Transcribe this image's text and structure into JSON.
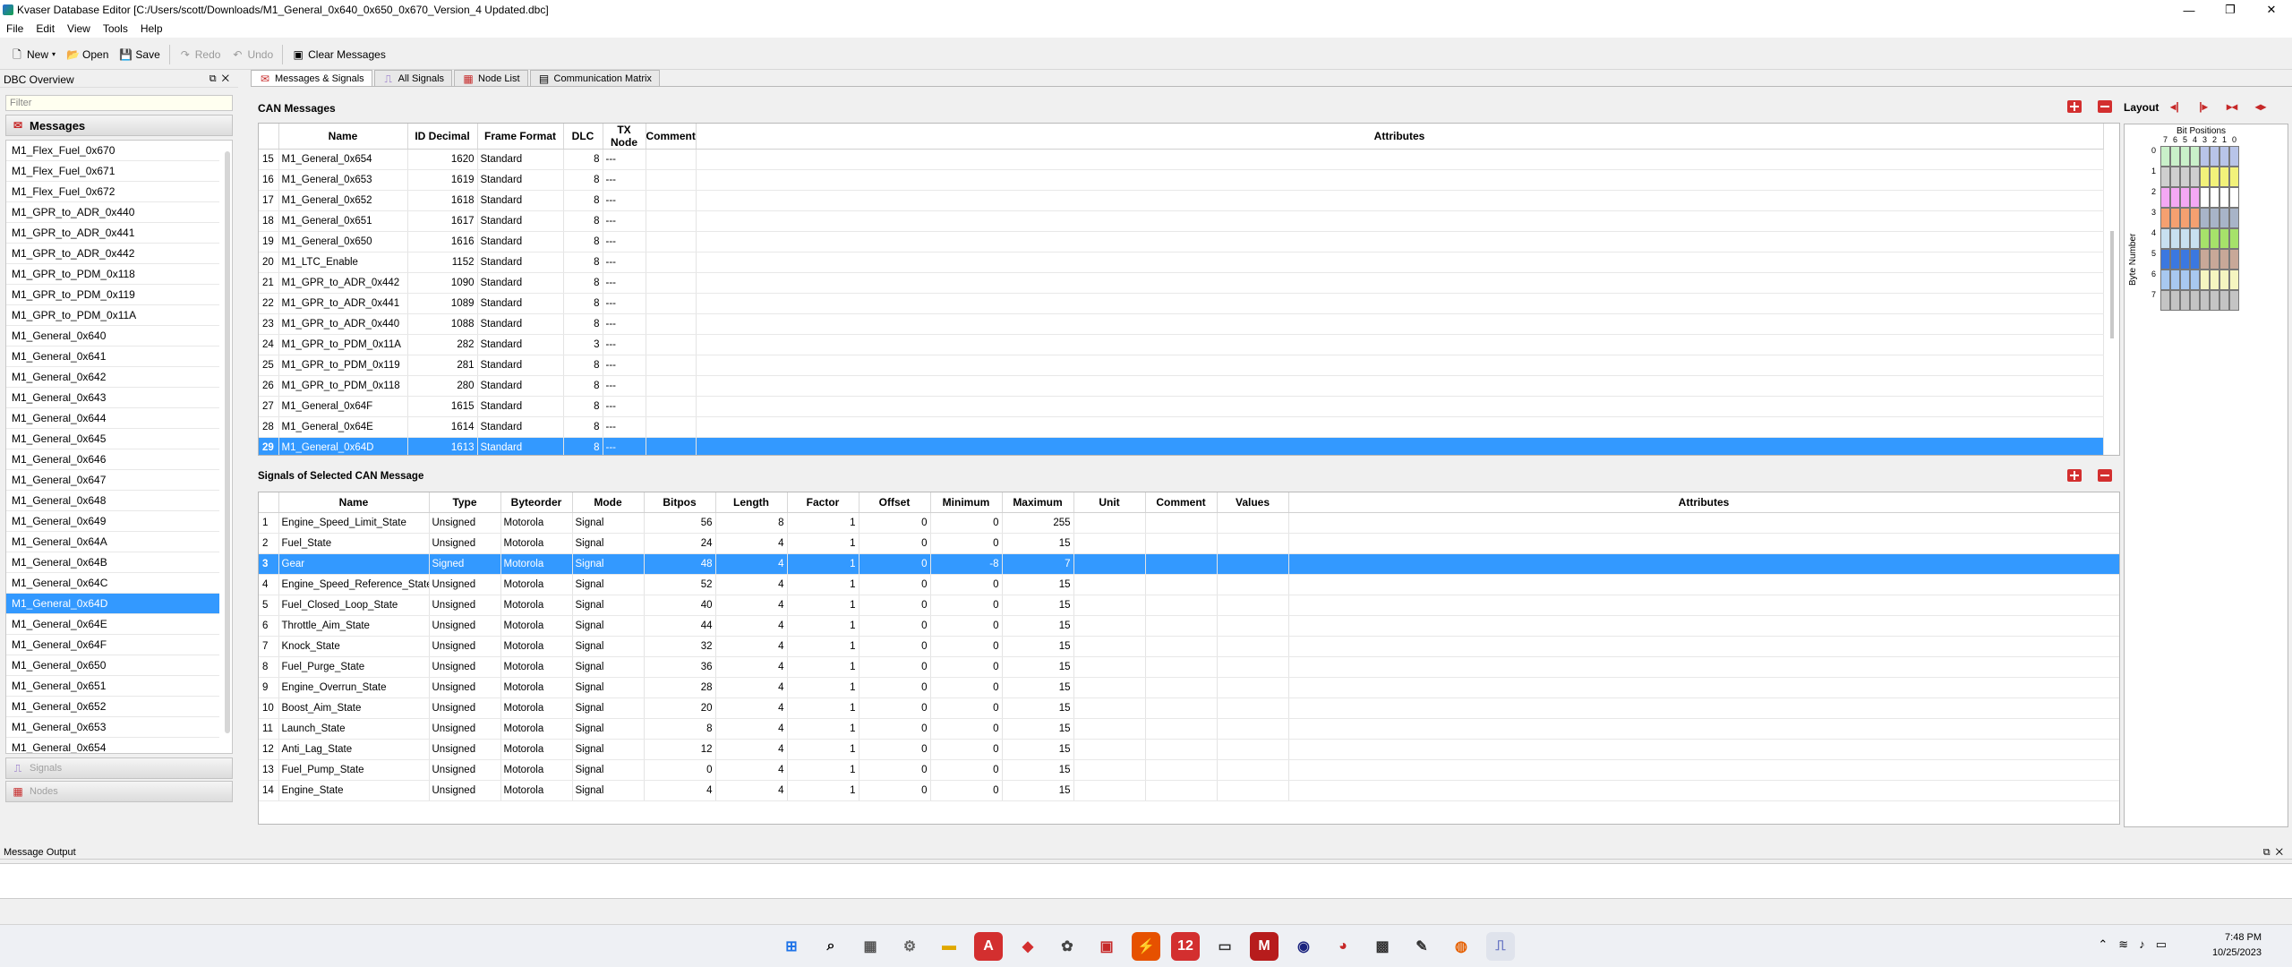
{
  "window": {
    "title": "Kvaser Database Editor [C:/Users/scott/Downloads/M1_General_0x640_0x650_0x670_Version_4 Updated.dbc]",
    "min": "—",
    "max": "❐",
    "close": "✕"
  },
  "menu": [
    "File",
    "Edit",
    "View",
    "Tools",
    "Help"
  ],
  "toolbar": {
    "new": "New",
    "open": "Open",
    "save": "Save",
    "redo": "Redo",
    "undo": "Undo",
    "clear": "Clear Messages"
  },
  "left": {
    "header": "DBC Overview",
    "filter_placeholder": "Filter",
    "messages_label": "Messages",
    "signals_label": "Signals",
    "nodes_label": "Nodes",
    "items": [
      "M1_Flex_Fuel_0x670",
      "M1_Flex_Fuel_0x671",
      "M1_Flex_Fuel_0x672",
      "M1_GPR_to_ADR_0x440",
      "M1_GPR_to_ADR_0x441",
      "M1_GPR_to_ADR_0x442",
      "M1_GPR_to_PDM_0x118",
      "M1_GPR_to_PDM_0x119",
      "M1_GPR_to_PDM_0x11A",
      "M1_General_0x640",
      "M1_General_0x641",
      "M1_General_0x642",
      "M1_General_0x643",
      "M1_General_0x644",
      "M1_General_0x645",
      "M1_General_0x646",
      "M1_General_0x647",
      "M1_General_0x648",
      "M1_General_0x649",
      "M1_General_0x64A",
      "M1_General_0x64B",
      "M1_General_0x64C",
      "M1_General_0x64D",
      "M1_General_0x64E",
      "M1_General_0x64F",
      "M1_General_0x650",
      "M1_General_0x651",
      "M1_General_0x652",
      "M1_General_0x653",
      "M1_General_0x654"
    ],
    "selected_index": 22
  },
  "tabs": [
    "Messages & Signals",
    "All Signals",
    "Node List",
    "Communication Matrix"
  ],
  "can": {
    "title": "CAN Messages",
    "layout_label": "Layout",
    "columns": [
      "Name",
      "ID Decimal",
      "Frame Format",
      "DLC",
      "TX Node",
      "Comment",
      "Attributes"
    ],
    "rows": [
      [
        "15",
        "M1_General_0x654",
        "1620",
        "Standard",
        "8",
        "---"
      ],
      [
        "16",
        "M1_General_0x653",
        "1619",
        "Standard",
        "8",
        "---"
      ],
      [
        "17",
        "M1_General_0x652",
        "1618",
        "Standard",
        "8",
        "---"
      ],
      [
        "18",
        "M1_General_0x651",
        "1617",
        "Standard",
        "8",
        "---"
      ],
      [
        "19",
        "M1_General_0x650",
        "1616",
        "Standard",
        "8",
        "---"
      ],
      [
        "20",
        "M1_LTC_Enable",
        "1152",
        "Standard",
        "8",
        "---"
      ],
      [
        "21",
        "M1_GPR_to_ADR_0x442",
        "1090",
        "Standard",
        "8",
        "---"
      ],
      [
        "22",
        "M1_GPR_to_ADR_0x441",
        "1089",
        "Standard",
        "8",
        "---"
      ],
      [
        "23",
        "M1_GPR_to_ADR_0x440",
        "1088",
        "Standard",
        "8",
        "---"
      ],
      [
        "24",
        "M1_GPR_to_PDM_0x11A",
        "282",
        "Standard",
        "3",
        "---"
      ],
      [
        "25",
        "M1_GPR_to_PDM_0x119",
        "281",
        "Standard",
        "8",
        "---"
      ],
      [
        "26",
        "M1_GPR_to_PDM_0x118",
        "280",
        "Standard",
        "8",
        "---"
      ],
      [
        "27",
        "M1_General_0x64F",
        "1615",
        "Standard",
        "8",
        "---"
      ],
      [
        "28",
        "M1_General_0x64E",
        "1614",
        "Standard",
        "8",
        "---"
      ],
      [
        "29",
        "M1_General_0x64D",
        "1613",
        "Standard",
        "8",
        "---"
      ]
    ],
    "selected_row": 14
  },
  "signals": {
    "title": "Signals of Selected CAN Message",
    "columns": [
      "Name",
      "Type",
      "Byteorder",
      "Mode",
      "Bitpos",
      "Length",
      "Factor",
      "Offset",
      "Minimum",
      "Maximum",
      "Unit",
      "Comment",
      "Values",
      "Attributes"
    ],
    "rows": [
      [
        "1",
        "Engine_Speed_Limit_State",
        "Unsigned",
        "Motorola",
        "Signal",
        "56",
        "8",
        "1",
        "0",
        "0",
        "255"
      ],
      [
        "2",
        "Fuel_State",
        "Unsigned",
        "Motorola",
        "Signal",
        "24",
        "4",
        "1",
        "0",
        "0",
        "15"
      ],
      [
        "3",
        "Gear",
        "Signed",
        "Motorola",
        "Signal",
        "48",
        "4",
        "1",
        "0",
        "-8",
        "7"
      ],
      [
        "4",
        "Engine_Speed_Reference_State",
        "Unsigned",
        "Motorola",
        "Signal",
        "52",
        "4",
        "1",
        "0",
        "0",
        "15"
      ],
      [
        "5",
        "Fuel_Closed_Loop_State",
        "Unsigned",
        "Motorola",
        "Signal",
        "40",
        "4",
        "1",
        "0",
        "0",
        "15"
      ],
      [
        "6",
        "Throttle_Aim_State",
        "Unsigned",
        "Motorola",
        "Signal",
        "44",
        "4",
        "1",
        "0",
        "0",
        "15"
      ],
      [
        "7",
        "Knock_State",
        "Unsigned",
        "Motorola",
        "Signal",
        "32",
        "4",
        "1",
        "0",
        "0",
        "15"
      ],
      [
        "8",
        "Fuel_Purge_State",
        "Unsigned",
        "Motorola",
        "Signal",
        "36",
        "4",
        "1",
        "0",
        "0",
        "15"
      ],
      [
        "9",
        "Engine_Overrun_State",
        "Unsigned",
        "Motorola",
        "Signal",
        "28",
        "4",
        "1",
        "0",
        "0",
        "15"
      ],
      [
        "10",
        "Boost_Aim_State",
        "Unsigned",
        "Motorola",
        "Signal",
        "20",
        "4",
        "1",
        "0",
        "0",
        "15"
      ],
      [
        "11",
        "Launch_State",
        "Unsigned",
        "Motorola",
        "Signal",
        "8",
        "4",
        "1",
        "0",
        "0",
        "15"
      ],
      [
        "12",
        "Anti_Lag_State",
        "Unsigned",
        "Motorola",
        "Signal",
        "12",
        "4",
        "1",
        "0",
        "0",
        "15"
      ],
      [
        "13",
        "Fuel_Pump_State",
        "Unsigned",
        "Motorola",
        "Signal",
        "0",
        "4",
        "1",
        "0",
        "0",
        "15"
      ],
      [
        "14",
        "Engine_State",
        "Unsigned",
        "Motorola",
        "Signal",
        "4",
        "4",
        "1",
        "0",
        "0",
        "15"
      ]
    ],
    "selected_row": 2
  },
  "bitview": {
    "title": "Bit Positions",
    "bits": [
      "7",
      "6",
      "5",
      "4",
      "3",
      "2",
      "1",
      "0"
    ],
    "bytes": [
      "0",
      "1",
      "2",
      "3",
      "4",
      "5",
      "6",
      "7"
    ],
    "ylabel": "Byte Number",
    "byte_colors": [
      [
        "#c9f0c9",
        "#c9f0c9",
        "#c9f0c9",
        "#c9f0c9",
        "#b8c4e8",
        "#b8c4e8",
        "#b8c4e8",
        "#b8c4e8"
      ],
      [
        "#cfcfcf",
        "#cfcfcf",
        "#cfcfcf",
        "#cfcfcf",
        "#f2f27a",
        "#f2f27a",
        "#f2f27a",
        "#f2f27a"
      ],
      [
        "#f4a8f4",
        "#f4a8f4",
        "#f4a8f4",
        "#f4a8f4",
        "#ffffff",
        "#ffffff",
        "#ffffff",
        "#ffffff"
      ],
      [
        "#f5a070",
        "#f5a070",
        "#f5a070",
        "#f5a070",
        "#a8b4c8",
        "#a8b4c8",
        "#a8b4c8",
        "#a8b4c8"
      ],
      [
        "#c8e0f0",
        "#c8e0f0",
        "#c8e0f0",
        "#c8e0f0",
        "#a6e26a",
        "#a6e26a",
        "#a6e26a",
        "#a6e26a"
      ],
      [
        "#3b78e0",
        "#3b78e0",
        "#3b78e0",
        "#3b78e0",
        "#c8a898",
        "#c8a898",
        "#c8a898",
        "#c8a898"
      ],
      [
        "#a8c8f0",
        "#a8c8f0",
        "#a8c8f0",
        "#a8c8f0",
        "#f5f5c0",
        "#f5f5c0",
        "#f5f5c0",
        "#f5f5c0"
      ],
      [
        "#c4c4c4",
        "#c4c4c4",
        "#c4c4c4",
        "#c4c4c4",
        "#c4c4c4",
        "#c4c4c4",
        "#c4c4c4",
        "#c4c4c4"
      ]
    ]
  },
  "output": {
    "title": "Message Output"
  },
  "taskbar": {
    "time": "7:48 PM",
    "date": "10/25/2023"
  }
}
